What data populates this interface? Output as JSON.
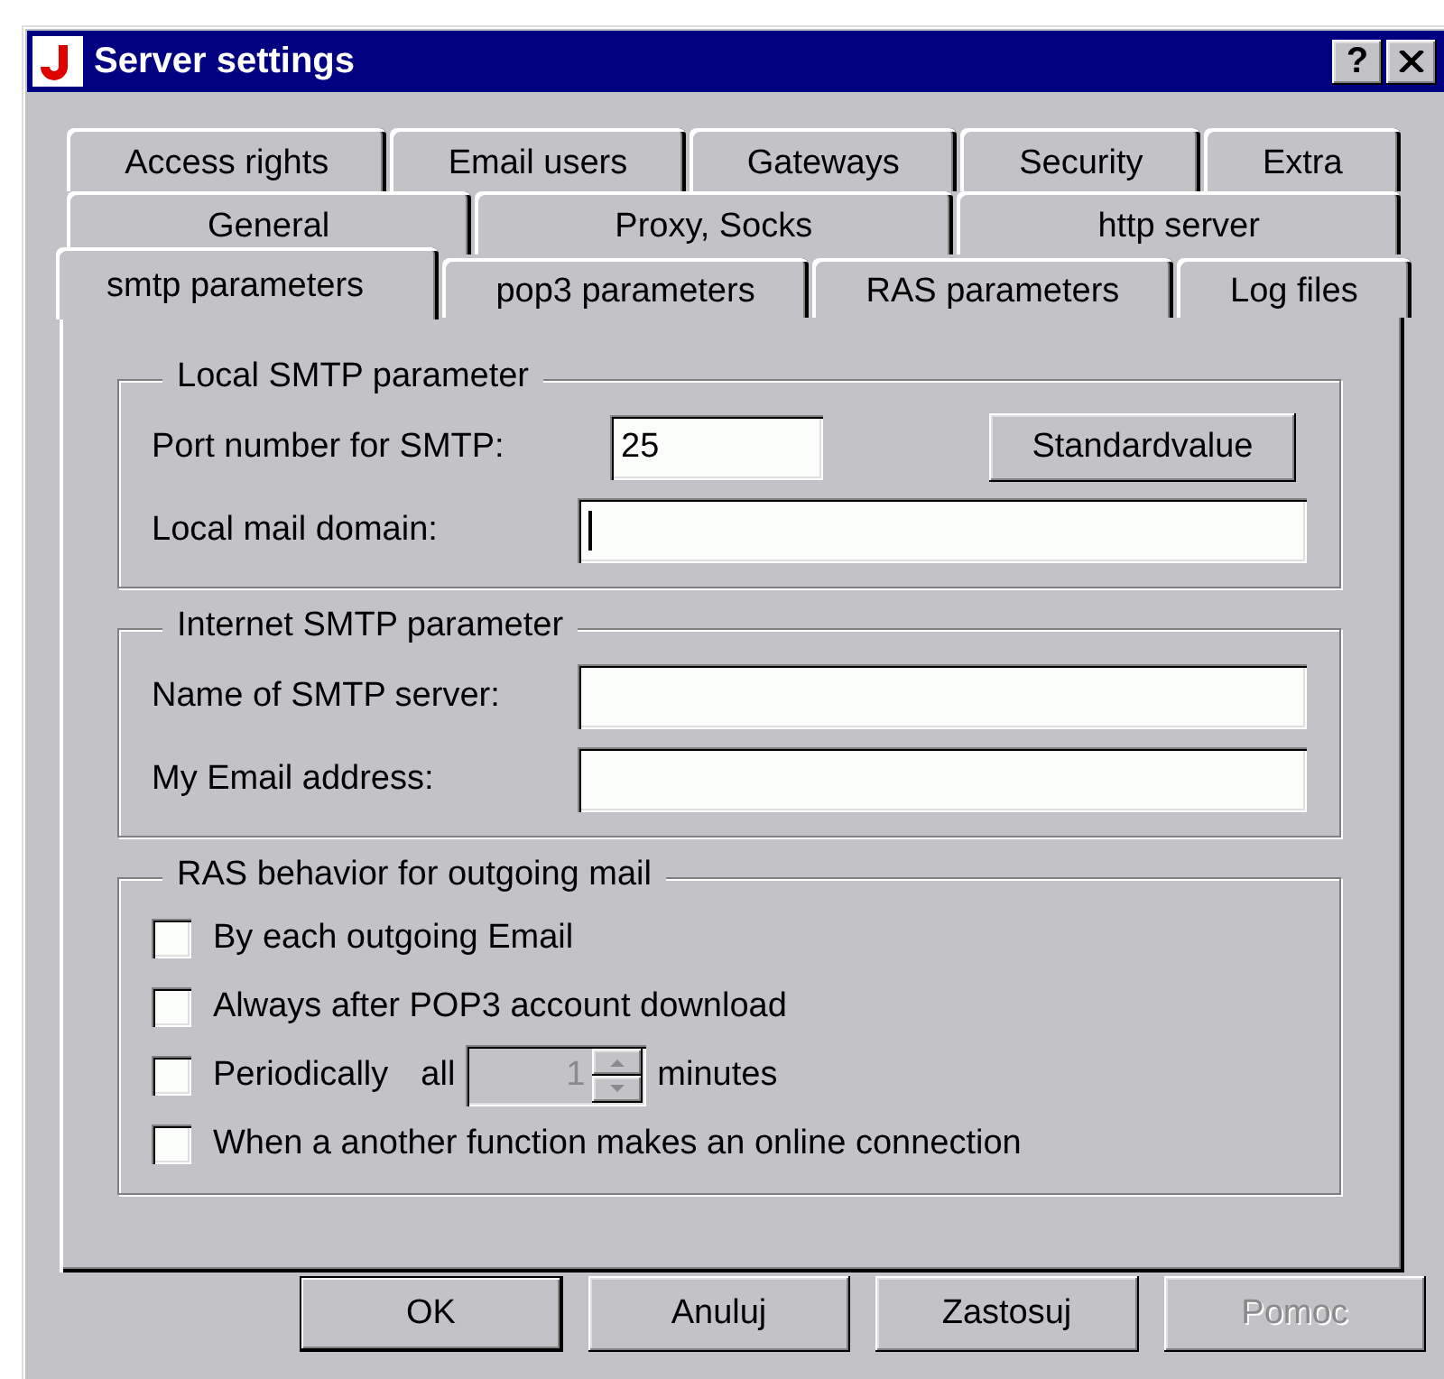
{
  "window": {
    "title": "Server settings",
    "help_button": "?"
  },
  "tabs": [
    [
      {
        "label": "Access rights",
        "selected": false
      },
      {
        "label": "Email users",
        "selected": false
      },
      {
        "label": "Gateways",
        "selected": false
      },
      {
        "label": "Security",
        "selected": false
      },
      {
        "label": "Extra",
        "selected": false
      }
    ],
    [
      {
        "label": "General",
        "selected": false
      },
      {
        "label": "Proxy, Socks",
        "selected": false
      },
      {
        "label": "http server",
        "selected": false
      }
    ],
    [
      {
        "label": "smtp parameters",
        "selected": true
      },
      {
        "label": "pop3 parameters",
        "selected": false
      },
      {
        "label": "RAS parameters",
        "selected": false
      },
      {
        "label": "Log files",
        "selected": false
      }
    ]
  ],
  "groups": [
    {
      "title": "Local SMTP parameter",
      "kind": "fields",
      "rows": [
        {
          "label": "Port number for SMTP:",
          "value": "25",
          "kind": "number",
          "focused": false,
          "button": "Standardvalue"
        },
        {
          "label": "Local mail domain:",
          "value": "",
          "kind": "text",
          "focused": true
        }
      ]
    },
    {
      "title": "Internet SMTP parameter",
      "kind": "fields",
      "rows": [
        {
          "label": "Name of SMTP server:",
          "value": "",
          "kind": "text",
          "focused": false
        },
        {
          "label": "My Email address:",
          "value": "",
          "kind": "text",
          "focused": false
        }
      ]
    },
    {
      "title": "RAS behavior for outgoing mail",
      "kind": "checks",
      "items": [
        {
          "label": "By each outgoing Email",
          "checked": false,
          "kind": "plain"
        },
        {
          "label": "Always after POP3 account download",
          "checked": false,
          "kind": "plain"
        },
        {
          "label": "Periodically",
          "checked": false,
          "kind": "interval",
          "prefix": "all",
          "spinner": {
            "value": "1",
            "disabled": true
          },
          "suffix": "minutes"
        },
        {
          "label": "When a another function makes an online connection",
          "checked": false,
          "kind": "plain"
        }
      ]
    }
  ],
  "buttons": [
    {
      "label": "OK",
      "default": true,
      "disabled": false
    },
    {
      "label": "Anuluj",
      "default": false,
      "disabled": false
    },
    {
      "label": "Zastosuj",
      "default": false,
      "disabled": false
    },
    {
      "label": "Pomoc",
      "default": false,
      "disabled": true
    }
  ]
}
